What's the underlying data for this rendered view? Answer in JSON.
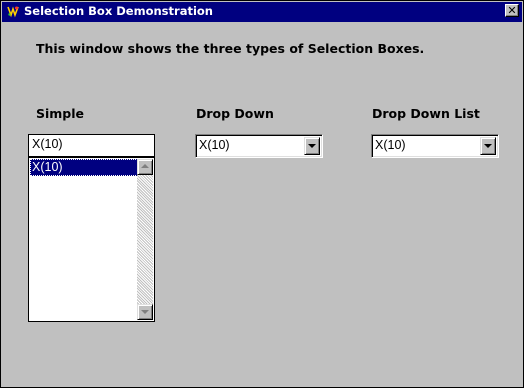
{
  "window": {
    "title": "Selection Box Demonstration",
    "close_symbol": "✕",
    "title_color": "#000080",
    "background": "#c0c0c0"
  },
  "description": "This window shows the three types of Selection Boxes.",
  "simple": {
    "label": "Simple",
    "edit_value": "X(10)",
    "list_items": [
      "X(10)"
    ],
    "selected_index": 0
  },
  "drop_down": {
    "label": "Drop Down",
    "value": "X(10)"
  },
  "drop_down_list": {
    "label": "Drop Down List",
    "value": "X(10)"
  },
  "icons": {
    "app": "app-logo-icon",
    "close": "close-icon",
    "scroll_up": "scroll-up-arrow-icon",
    "scroll_down": "scroll-down-arrow-icon",
    "dropdown": "chevron-down-icon"
  }
}
